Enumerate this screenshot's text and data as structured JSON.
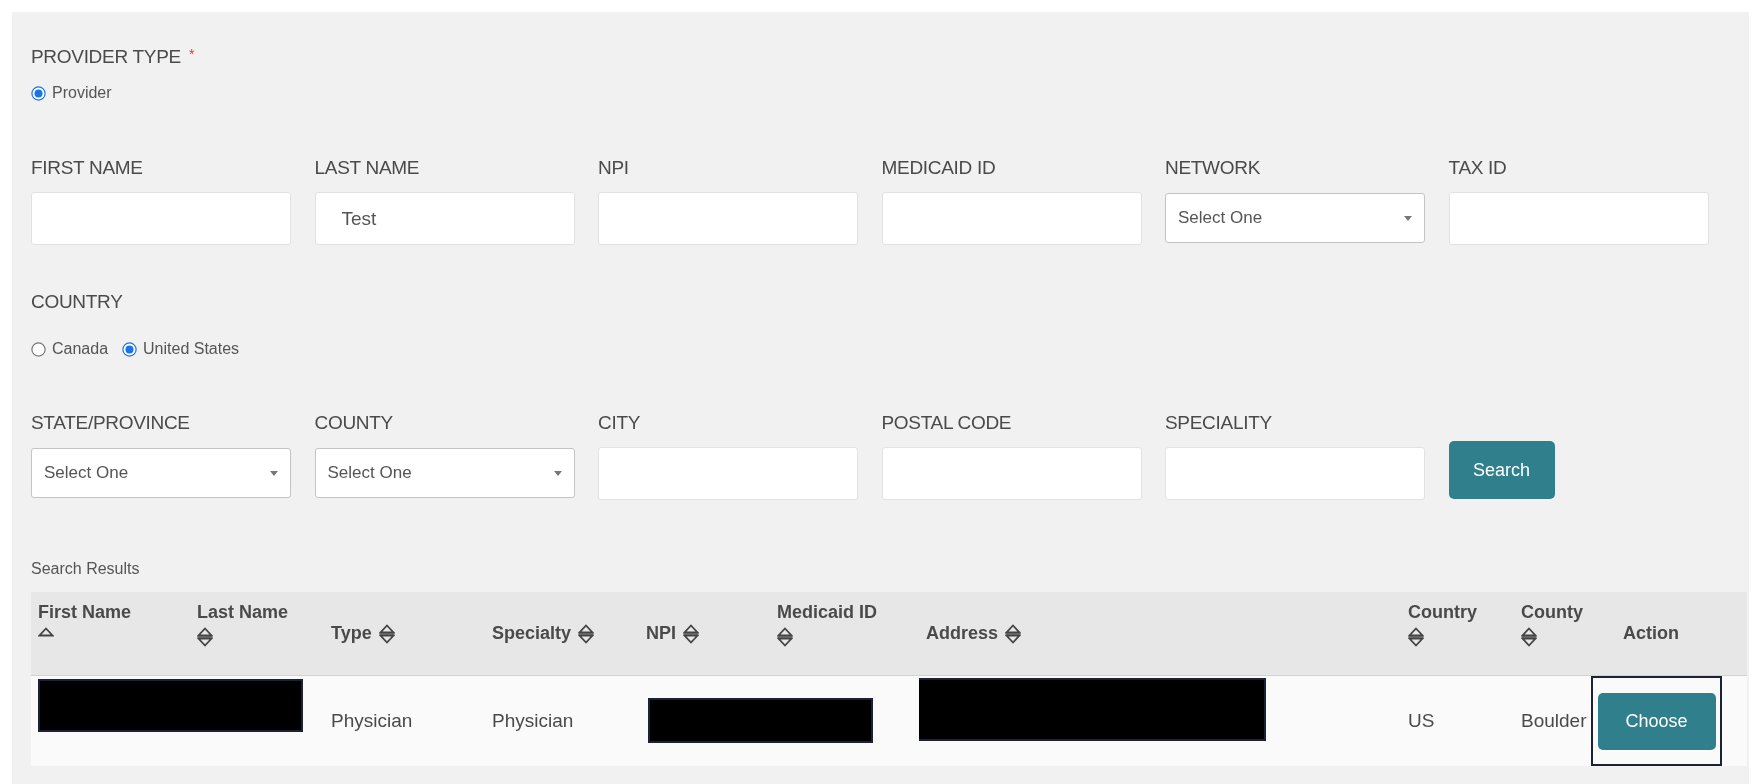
{
  "provider_type": {
    "label": "PROVIDER TYPE",
    "required_mark": "*",
    "options": [
      {
        "label": "Provider",
        "selected": true
      }
    ]
  },
  "fields_row_1": [
    {
      "label": "FIRST NAME",
      "kind": "text"
    },
    {
      "label": "LAST NAME",
      "kind": "text",
      "value": "Test"
    },
    {
      "label": "NPI",
      "kind": "text"
    },
    {
      "label": "MEDICAID ID",
      "kind": "text"
    },
    {
      "label": "NETWORK",
      "kind": "select",
      "value": "Select One"
    },
    {
      "label": "TAX ID",
      "kind": "text"
    }
  ],
  "country": {
    "label": "COUNTRY",
    "options": [
      {
        "label": "Canada",
        "selected": false
      },
      {
        "label": "United States",
        "selected": true
      }
    ]
  },
  "fields_row_2": [
    {
      "label": "STATE/PROVINCE",
      "kind": "select",
      "value": "Select One"
    },
    {
      "label": "COUNTY",
      "kind": "select",
      "value": "Select One"
    },
    {
      "label": "CITY",
      "kind": "text"
    },
    {
      "label": "POSTAL CODE",
      "kind": "text"
    },
    {
      "label": "SPECIALITY",
      "kind": "text"
    }
  ],
  "search_button": "Search",
  "results": {
    "title": "Search Results",
    "columns": [
      {
        "label": "First Name",
        "sortable": true,
        "sorted_ascending": true
      },
      {
        "label": "Last Name",
        "sortable": true,
        "sorted_ascending": false
      },
      {
        "label": "Type",
        "sortable": true,
        "sorted_ascending": false
      },
      {
        "label": "Specialty",
        "sortable": true,
        "sorted_ascending": false
      },
      {
        "label": "NPI",
        "sortable": true,
        "sorted_ascending": false
      },
      {
        "label": "Medicaid ID",
        "sortable": true,
        "sorted_ascending": false
      },
      {
        "label": "Address",
        "sortable": true,
        "sorted_ascending": false
      },
      {
        "label": "Country",
        "sortable": true,
        "sorted_ascending": false
      },
      {
        "label": "County",
        "sortable": true,
        "sorted_ascending": false
      },
      {
        "label": "Action",
        "sortable": false
      }
    ],
    "rows": [
      {
        "cells": [
          {
            "kind": "redacted"
          },
          {
            "kind": "redacted"
          },
          {
            "kind": "text",
            "text": "Physician"
          },
          {
            "kind": "text",
            "text": "Physician"
          },
          {
            "kind": "redacted"
          },
          {
            "kind": "redacted"
          },
          {
            "kind": "redacted"
          },
          {
            "kind": "text",
            "text": "US"
          },
          {
            "kind": "text",
            "text": "Boulder"
          },
          {
            "kind": "button",
            "text": "Choose",
            "highlighted": true
          }
        ]
      }
    ]
  }
}
